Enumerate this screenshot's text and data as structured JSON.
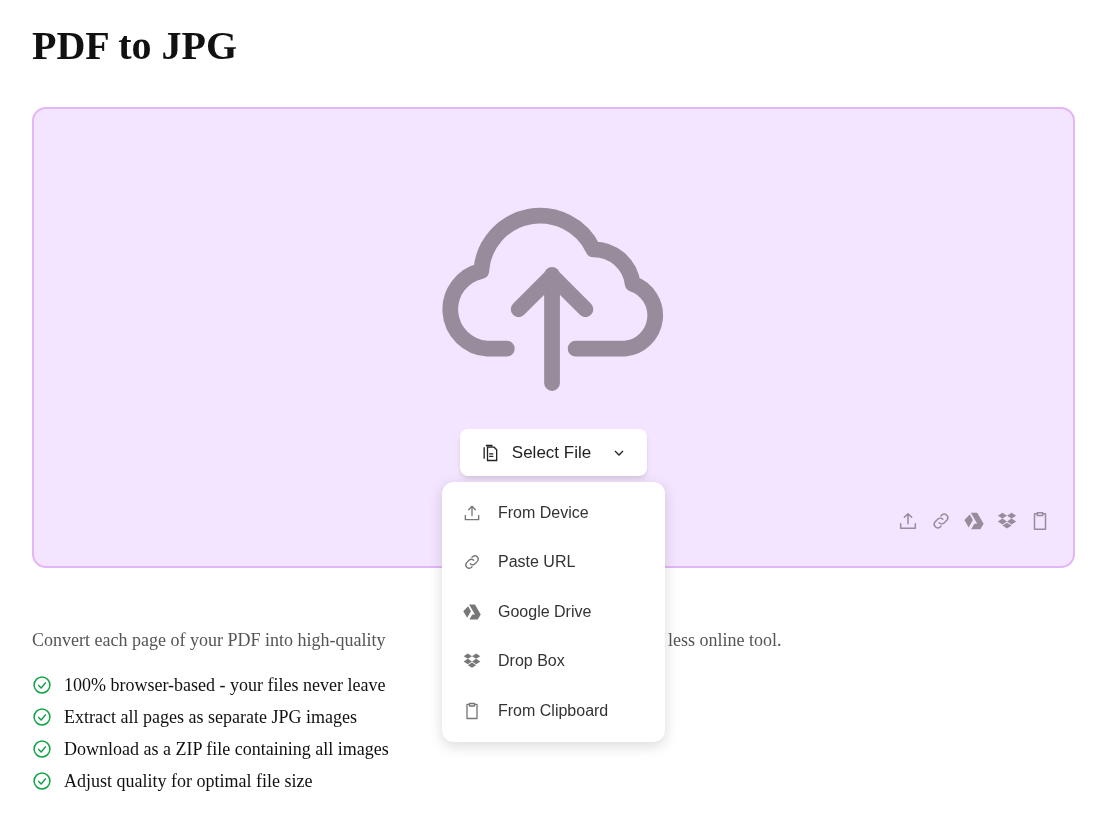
{
  "title": "PDF to JPG",
  "dropzone": {
    "button": {
      "label": "Select File",
      "expanded": true
    },
    "menu": [
      {
        "kind": "device",
        "label": "From Device"
      },
      {
        "kind": "url",
        "label": "Paste URL"
      },
      {
        "kind": "drive",
        "label": "Google Drive"
      },
      {
        "kind": "dropbox",
        "label": "Drop Box"
      },
      {
        "kind": "clipboard",
        "label": "From Clipboard"
      }
    ],
    "source_icons": [
      {
        "kind": "device"
      },
      {
        "kind": "url"
      },
      {
        "kind": "drive"
      },
      {
        "kind": "dropbox"
      },
      {
        "kind": "clipboard"
      }
    ]
  },
  "description": [
    "Convert each page of your PDF into high-quality",
    "less online tool."
  ],
  "features": [
    "100% browser-based - your files never leave",
    "Extract all pages as separate JPG images",
    "Download as a ZIP file containing all images",
    "Adjust quality for optimal file size"
  ]
}
